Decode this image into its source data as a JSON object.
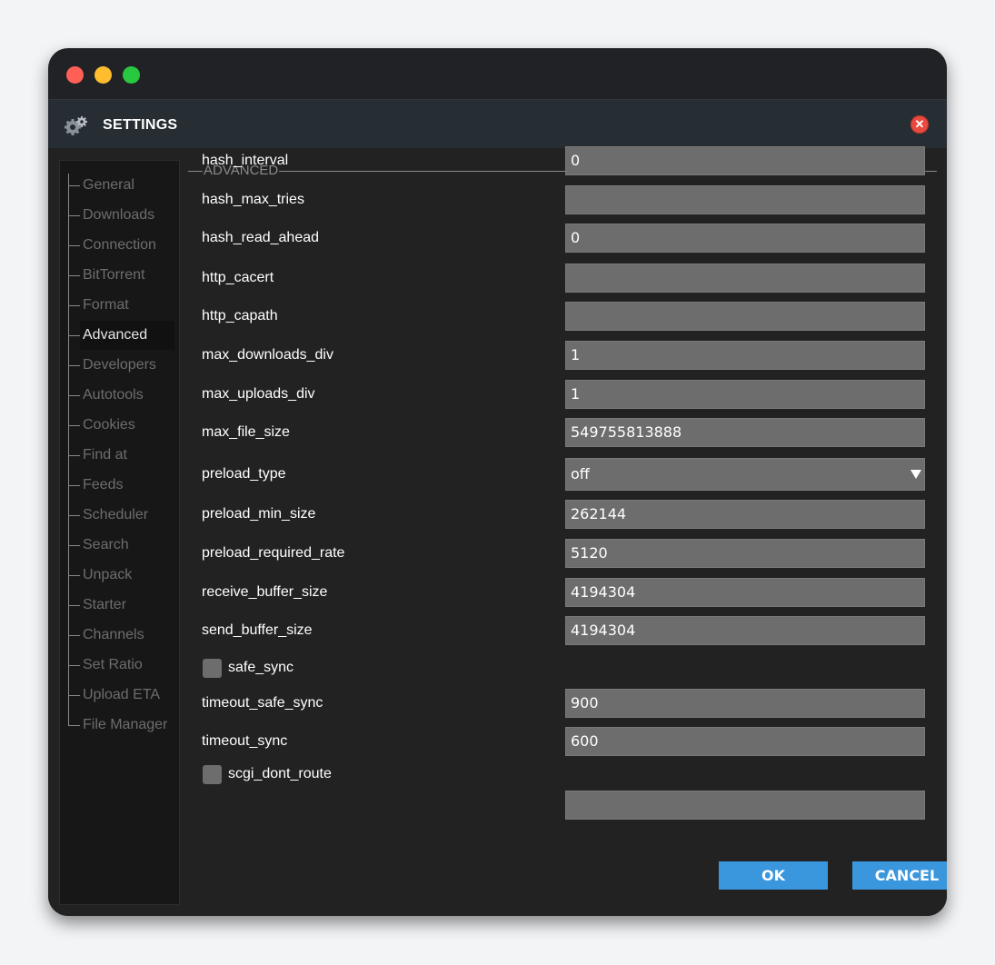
{
  "dialog": {
    "title": "SETTINGS",
    "icons": {
      "app": "gear-icon",
      "close": "close-icon"
    },
    "close_glyph": "✕"
  },
  "sidebar": {
    "items": [
      {
        "label": "General",
        "active": false
      },
      {
        "label": "Downloads",
        "active": false
      },
      {
        "label": "Connection",
        "active": false
      },
      {
        "label": "BitTorrent",
        "active": false
      },
      {
        "label": "Format",
        "active": false
      },
      {
        "label": "Advanced",
        "active": true
      },
      {
        "label": "Developers",
        "active": false
      },
      {
        "label": "Autotools",
        "active": false
      },
      {
        "label": "Cookies",
        "active": false
      },
      {
        "label": "Find at",
        "active": false
      },
      {
        "label": "Feeds",
        "active": false
      },
      {
        "label": "Scheduler",
        "active": false
      },
      {
        "label": "Search",
        "active": false
      },
      {
        "label": "Unpack",
        "active": false
      },
      {
        "label": "Starter",
        "active": false
      },
      {
        "label": "Channels",
        "active": false
      },
      {
        "label": "Set Ratio",
        "active": false
      },
      {
        "label": "Upload ETA",
        "active": false
      },
      {
        "label": "File Manager",
        "active": false
      }
    ]
  },
  "section": {
    "title": "ADVANCED",
    "rows": [
      {
        "label": "hash_interval",
        "value": "0",
        "kind": "text"
      },
      {
        "label": "hash_max_tries",
        "value": "",
        "kind": "text"
      },
      {
        "label": "hash_read_ahead",
        "value": "0",
        "kind": "text"
      },
      {
        "label": "http_cacert",
        "value": "",
        "kind": "text"
      },
      {
        "label": "http_capath",
        "value": "",
        "kind": "text"
      },
      {
        "label": "max_downloads_div",
        "value": "1",
        "kind": "text"
      },
      {
        "label": "max_uploads_div",
        "value": "1",
        "kind": "text"
      },
      {
        "label": "max_file_size",
        "value": "549755813888",
        "kind": "text"
      },
      {
        "label": "preload_type",
        "value": "off",
        "kind": "select"
      },
      {
        "label": "preload_min_size",
        "value": "262144",
        "kind": "text"
      },
      {
        "label": "preload_required_rate",
        "value": "5120",
        "kind": "text"
      },
      {
        "label": "receive_buffer_size",
        "value": "4194304",
        "kind": "text"
      },
      {
        "label": "send_buffer_size",
        "value": "4194304",
        "kind": "text"
      },
      {
        "label": "safe_sync",
        "checked": false,
        "kind": "checkbox"
      },
      {
        "label": "timeout_safe_sync",
        "value": "900",
        "kind": "text"
      },
      {
        "label": "timeout_sync",
        "value": "600",
        "kind": "text"
      },
      {
        "label": "scgi_dont_route",
        "checked": false,
        "kind": "checkbox"
      },
      {
        "label": "",
        "value": "",
        "kind": "text"
      }
    ]
  },
  "buttons": {
    "ok": "OK",
    "cancel": "CANCEL"
  },
  "colors": {
    "accent": "#3a96dd",
    "close": "#e94a3f",
    "field_bg": "#6d6d6d"
  }
}
